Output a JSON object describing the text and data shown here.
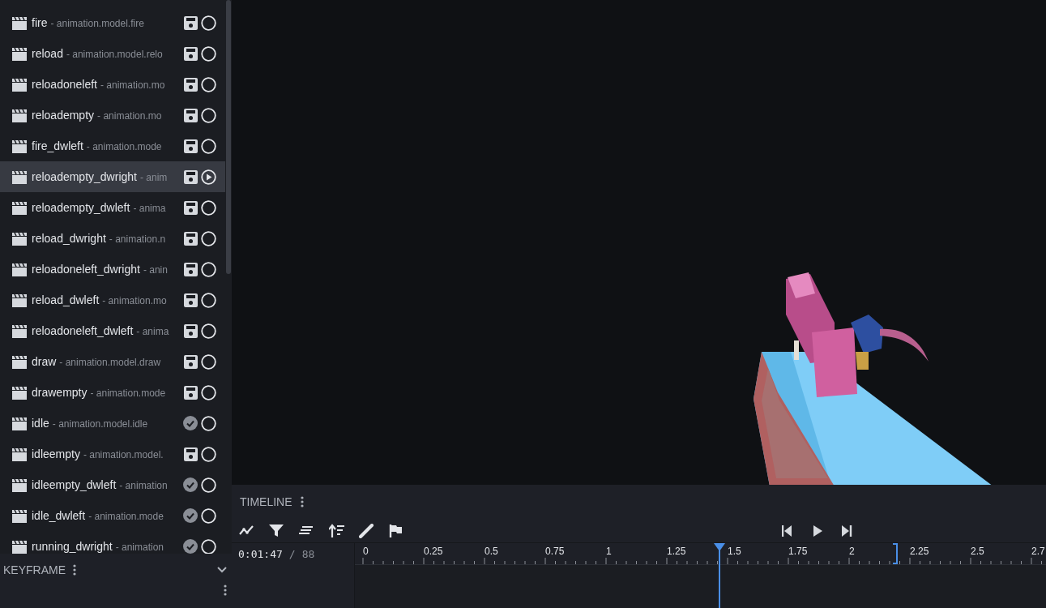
{
  "animations": [
    {
      "name": "fire",
      "path": "- animation.model.fire",
      "kind": "save",
      "selected": false
    },
    {
      "name": "reload",
      "path": "- animation.model.relo",
      "kind": "save",
      "selected": false
    },
    {
      "name": "reloadoneleft",
      "path": "- animation.mo",
      "kind": "save",
      "selected": false
    },
    {
      "name": "reloadempty",
      "path": "- animation.mo",
      "kind": "save",
      "selected": false
    },
    {
      "name": "fire_dwleft",
      "path": "- animation.mode",
      "kind": "save",
      "selected": false
    },
    {
      "name": "reloadempty_dwright",
      "path": "- anim",
      "kind": "save",
      "selected": true
    },
    {
      "name": "reloadempty_dwleft",
      "path": "- anima",
      "kind": "save",
      "selected": false
    },
    {
      "name": "reload_dwright",
      "path": "- animation.n",
      "kind": "save",
      "selected": false
    },
    {
      "name": "reloadoneleft_dwright",
      "path": "- anin",
      "kind": "save",
      "selected": false
    },
    {
      "name": "reload_dwleft",
      "path": "- animation.mo",
      "kind": "save",
      "selected": false
    },
    {
      "name": "reloadoneleft_dwleft",
      "path": "- anima",
      "kind": "save",
      "selected": false
    },
    {
      "name": "draw",
      "path": "- animation.model.draw",
      "kind": "save",
      "selected": false
    },
    {
      "name": "drawempty",
      "path": "- animation.mode",
      "kind": "save",
      "selected": false
    },
    {
      "name": "idle",
      "path": "- animation.model.idle",
      "kind": "check",
      "selected": false
    },
    {
      "name": "idleempty",
      "path": "- animation.model.",
      "kind": "save",
      "selected": false
    },
    {
      "name": "idleempty_dwleft",
      "path": "- animation",
      "kind": "check",
      "selected": false
    },
    {
      "name": "idle_dwleft",
      "path": "- animation.mode",
      "kind": "check",
      "selected": false
    },
    {
      "name": "running_dwright",
      "path": "- animation",
      "kind": "check",
      "selected": false
    }
  ],
  "keyframe_panel": {
    "title": "KEYFRAME"
  },
  "timeline": {
    "title": "TIMELINE",
    "tools": [
      {
        "kind": "graph"
      },
      {
        "kind": "filter"
      },
      {
        "kind": "align"
      },
      {
        "kind": "sort"
      },
      {
        "kind": "brush"
      },
      {
        "kind": "flag"
      }
    ],
    "playback": [
      {
        "kind": "start"
      },
      {
        "kind": "play"
      },
      {
        "kind": "end"
      }
    ],
    "time": "0:01:47",
    "separator": "/",
    "total": "88",
    "ticks": [
      "0",
      "0.25",
      "0.5",
      "0.75",
      "1",
      "1.25",
      "1.5",
      "1.75",
      "2",
      "2.25",
      "2.5",
      "2.7"
    ],
    "playhead": {
      "level": 0.527
    },
    "end_marker": {
      "level": 0.784
    }
  }
}
